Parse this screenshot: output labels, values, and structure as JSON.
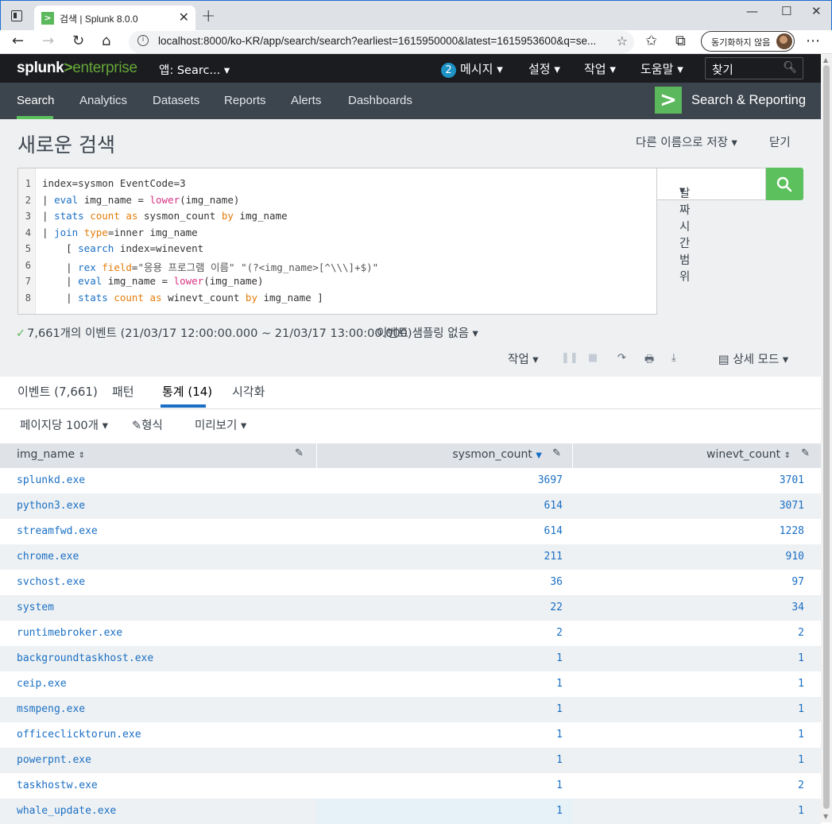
{
  "browser": {
    "tab_title": "검색 | Splunk 8.0.0",
    "favicon": ">",
    "url": "localhost:8000/ko-KR/app/search/search?earliest=1615950000&latest=1615953600&q=se...",
    "sync_label": "동기화하지 않음"
  },
  "splunk_header": {
    "logo_prefix": "splunk",
    "logo_gt": ">",
    "logo_suffix": "enterprise",
    "app_menu": "앱: Searc...",
    "messages_count": "2",
    "messages_label": "메시지",
    "settings_label": "설정",
    "activity_label": "작업",
    "help_label": "도움말",
    "find_placeholder": "찾기"
  },
  "app_nav": {
    "items": [
      "Search",
      "Analytics",
      "Datasets",
      "Reports",
      "Alerts",
      "Dashboards"
    ],
    "app_title": "Search & Reporting"
  },
  "page": {
    "title": "새로운 검색",
    "save_as": "다른 이름으로 저장",
    "close": "닫기",
    "time_range": "날짜 시간 범위"
  },
  "query_lines": [
    "index=sysmon EventCode=3",
    "| eval img_name = lower(img_name)",
    "| stats count as sysmon_count by img_name",
    "| join type=inner img_name",
    "    [ search index=winevent",
    "    | rex field=\"응용 프로그램 이름\" \"(?<img_name>[^\\\\\\]+$)\"",
    "    | eval img_name = lower(img_name)",
    "    | stats count as winevt_count by img_name ]"
  ],
  "status": {
    "events_summary": "7,661개의 이벤트 (21/03/17 12:00:00.000 ~ 21/03/17 13:00:00.000)",
    "sampling": "이벤트 샘플링 없음"
  },
  "job_bar": {
    "job_label": "작업",
    "mode_label": "상세 모드"
  },
  "results_tabs": {
    "events": "이벤트 (7,661)",
    "patterns": "패턴",
    "statistics": "통계 (14)",
    "visualization": "시각화"
  },
  "table_toolbar": {
    "per_page": "페이지당 100개",
    "format": "형식",
    "preview": "미리보기"
  },
  "table": {
    "columns": [
      "img_name",
      "sysmon_count",
      "winevt_count"
    ],
    "rows": [
      [
        "splunkd.exe",
        "3697",
        "3701"
      ],
      [
        "python3.exe",
        "614",
        "3071"
      ],
      [
        "streamfwd.exe",
        "614",
        "1228"
      ],
      [
        "chrome.exe",
        "211",
        "910"
      ],
      [
        "svchost.exe",
        "36",
        "97"
      ],
      [
        "system",
        "22",
        "34"
      ],
      [
        "runtimebroker.exe",
        "2",
        "2"
      ],
      [
        "backgroundtaskhost.exe",
        "1",
        "1"
      ],
      [
        "ceip.exe",
        "1",
        "1"
      ],
      [
        "msmpeng.exe",
        "1",
        "1"
      ],
      [
        "officeclicktorun.exe",
        "1",
        "1"
      ],
      [
        "powerpnt.exe",
        "1",
        "1"
      ],
      [
        "taskhostw.exe",
        "1",
        "2"
      ],
      [
        "whale_update.exe",
        "1",
        "1"
      ]
    ]
  },
  "colors": {
    "splunk_green": "#5cc05c",
    "link_blue": "#1a6fc4",
    "nav_bg": "#3c444d",
    "header_bg": "#1a1c20"
  }
}
